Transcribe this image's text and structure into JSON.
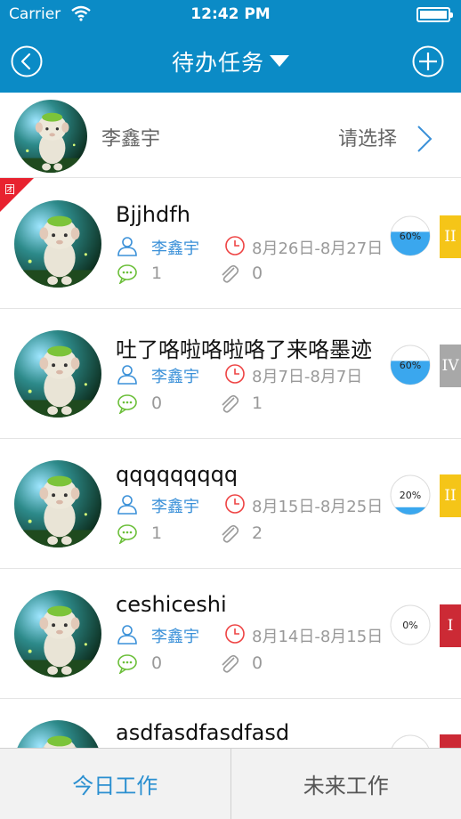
{
  "status_bar": {
    "carrier": "Carrier",
    "time": "12:42 PM"
  },
  "nav": {
    "title": "待办任务",
    "back_icon": "back-circle-icon",
    "add_icon": "plus-circle-icon"
  },
  "selector": {
    "name": "李鑫宇",
    "choose_label": "请选择"
  },
  "team_badge": {
    "label": "团",
    "color": "#e8222f"
  },
  "tasks": [
    {
      "title": "Bjjhdfh",
      "owner": "李鑫宇",
      "dates": "8月26日-8月27日",
      "comments": "1",
      "attachments": "0",
      "progress_label": "60%",
      "progress": 0.6,
      "level": "II",
      "level_color": "#f5c518"
    },
    {
      "title": "吐了咯啦咯啦咯了来咯墨迹",
      "owner": "李鑫宇",
      "dates": "8月7日-8月7日",
      "comments": "0",
      "attachments": "1",
      "progress_label": "60%",
      "progress": 0.6,
      "level": "IV",
      "level_color": "#a8a8a8"
    },
    {
      "title": "qqqqqqqqq",
      "owner": "李鑫宇",
      "dates": "8月15日-8月25日",
      "comments": "1",
      "attachments": "2",
      "progress_label": "20%",
      "progress": 0.2,
      "level": "II",
      "level_color": "#f5c518"
    },
    {
      "title": "ceshiceshi",
      "owner": "李鑫宇",
      "dates": "8月14日-8月15日",
      "comments": "0",
      "attachments": "0",
      "progress_label": "0%",
      "progress": 0,
      "level": "I",
      "level_color": "#cc2a35"
    },
    {
      "title": "asdfasdfasdfasd",
      "level_color": "#cc2a35"
    }
  ],
  "tabs": [
    {
      "label": "今日工作",
      "active": true
    },
    {
      "label": "未来工作",
      "active": false
    }
  ],
  "colors": {
    "brand": "#0b8bc6",
    "link": "#3a90d8",
    "progress_fill": "#3aa7ee"
  }
}
